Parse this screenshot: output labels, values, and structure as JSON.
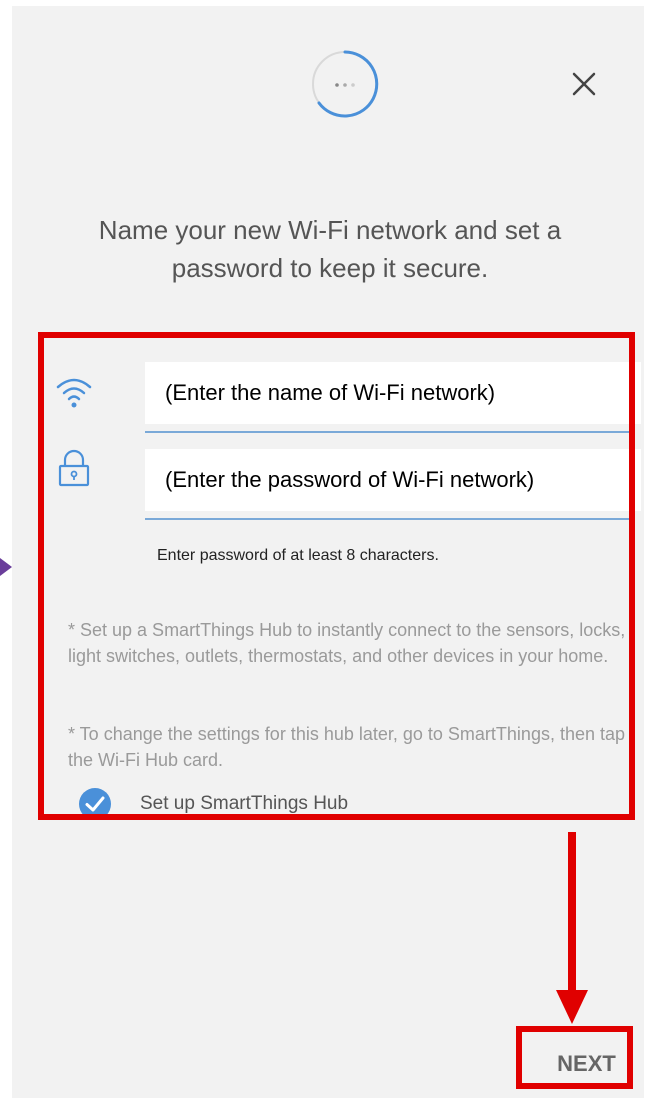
{
  "header": {
    "progress_icon": "loading-spinner-icon",
    "close_icon": "close-icon"
  },
  "headline": "Name your new Wi-Fi network and set a password to keep it secure.",
  "form": {
    "network_name": {
      "icon": "wifi-icon",
      "value": "(Enter the name of Wi-Fi network)"
    },
    "password": {
      "icon": "lock-icon",
      "value": "(Enter the password of Wi-Fi network)",
      "hint": "Enter password of at least 8 characters."
    }
  },
  "notes": [
    "* Set up a SmartThings Hub to instantly connect to the sensors, locks, light switches, outlets, thermostats, and other devices in your home.",
    "* To change the settings for this hub later, go to SmartThings, then tap the Wi-Fi Hub card."
  ],
  "setup_hub": {
    "label": "Set up SmartThings Hub",
    "checked": true
  },
  "footer": {
    "next_label": "NEXT"
  },
  "colors": {
    "background": "#f2f2f2",
    "accent": "#4a90d9",
    "callout": "#e00000"
  }
}
